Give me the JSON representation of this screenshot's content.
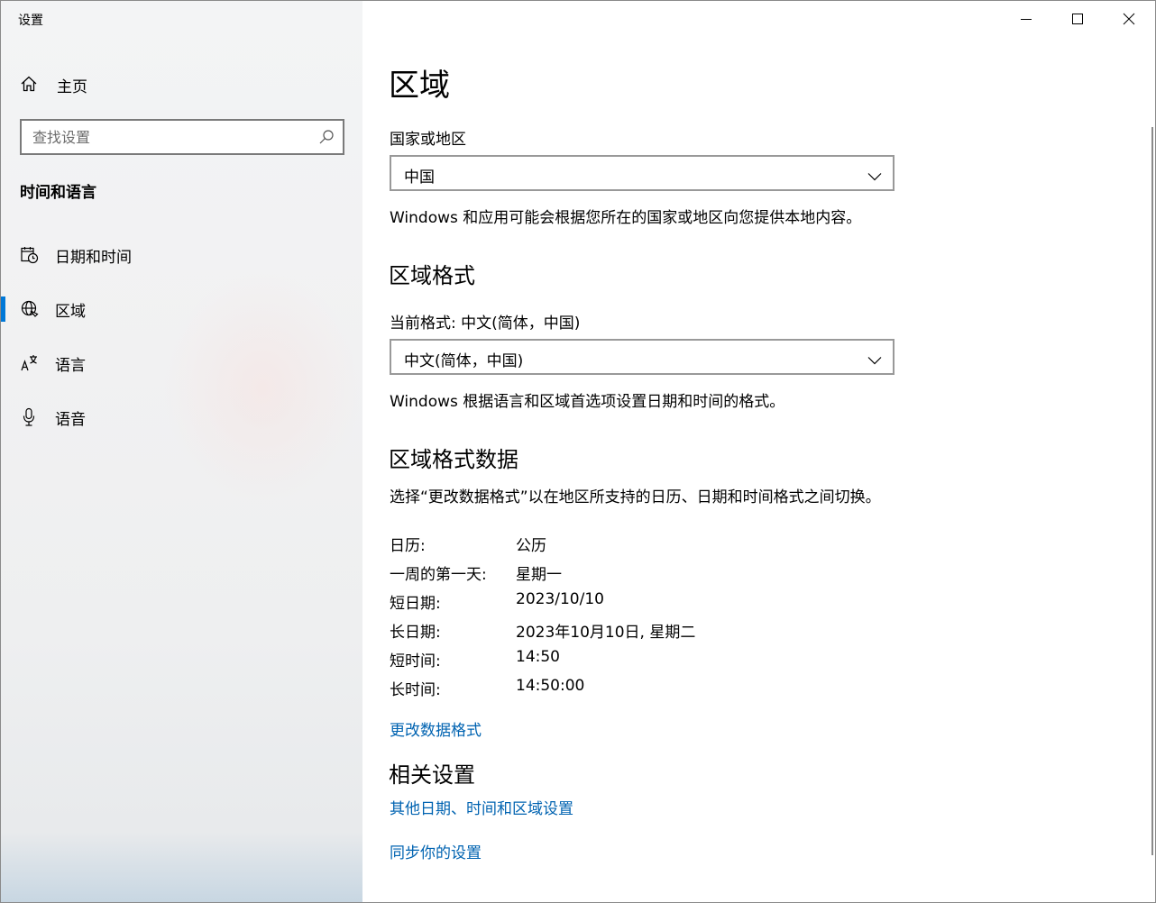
{
  "window": {
    "title": "设置"
  },
  "sidebar": {
    "home_label": "主页",
    "search_placeholder": "查找设置",
    "section_title": "时间和语言",
    "items": [
      {
        "label": "日期和时间",
        "icon": "calendar-clock-icon",
        "selected": false
      },
      {
        "label": "区域",
        "icon": "globe-icon",
        "selected": true
      },
      {
        "label": "语言",
        "icon": "language-icon",
        "selected": false
      },
      {
        "label": "语音",
        "icon": "microphone-icon",
        "selected": false
      }
    ]
  },
  "main": {
    "title": "区域",
    "country": {
      "label": "国家或地区",
      "value": "中国",
      "description": "Windows 和应用可能会根据您所在的国家或地区向您提供本地内容。"
    },
    "format": {
      "heading": "区域格式",
      "current_label": "当前格式: 中文(简体，中国)",
      "value": "中文(简体，中国)",
      "description": "Windows 根据语言和区域首选项设置日期和时间的格式。"
    },
    "format_data": {
      "heading": "区域格式数据",
      "description": "选择“更改数据格式”以在地区所支持的日历、日期和时间格式之间切换。",
      "rows": [
        {
          "key": "日历:",
          "value": "公历"
        },
        {
          "key": "一周的第一天:",
          "value": "星期一"
        },
        {
          "key": "短日期:",
          "value": "2023/10/10"
        },
        {
          "key": "长日期:",
          "value": "2023年10月10日, 星期二"
        },
        {
          "key": "短时间:",
          "value": "14:50"
        },
        {
          "key": "长时间:",
          "value": "14:50:00"
        }
      ],
      "change_link": "更改数据格式"
    },
    "related": {
      "heading": "相关设置",
      "links": [
        "其他日期、时间和区域设置",
        "同步你的设置"
      ]
    }
  },
  "colors": {
    "accent": "#0078d7",
    "link": "#0063b1"
  }
}
